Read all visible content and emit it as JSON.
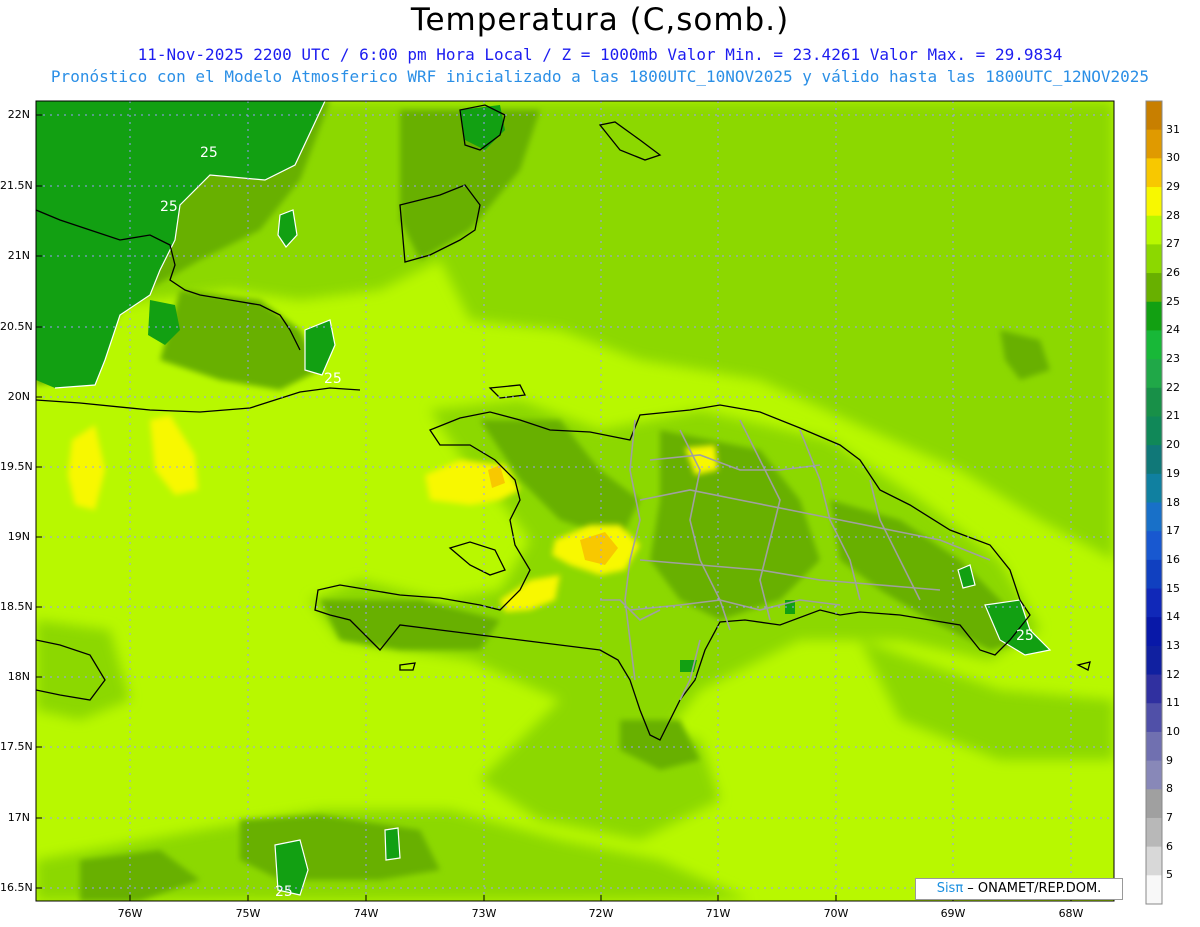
{
  "title": "Temperatura (C,somb.)",
  "subtitle_line1": "11-Nov-2025 2200 UTC / 6:00 pm Hora Local / Z = 1000mb   Valor Min. = 23.4261  Valor Max. = 29.9834",
  "subtitle_line2": "Pronóstico con el Modelo Atmosferico WRF inicializado a las 1800UTC_10NOV2025 y válido hasta las  1800UTC_12NOV2025",
  "credit": {
    "brand": "Sisπ",
    "text": " – ONAMET/REP.DOM."
  },
  "map": {
    "lat_labels": [
      "22N",
      "21.5N",
      "21N",
      "20.5N",
      "20N",
      "19.5N",
      "19N",
      "18.5N",
      "18N",
      "17.5N",
      "17N",
      "16.5N"
    ],
    "lon_labels": [
      "76W",
      "75W",
      "74W",
      "73W",
      "72W",
      "71W",
      "70W",
      "69W",
      "68W"
    ],
    "contour_labels": [
      "25",
      "25",
      "25",
      "25",
      "25"
    ],
    "min_value": 23.4261,
    "max_value": 29.9834,
    "units": "C",
    "level": "1000mb"
  },
  "colorbar": {
    "labels": [
      "31",
      "30",
      "29",
      "28",
      "27",
      "26",
      "25",
      "24",
      "23",
      "22",
      "21",
      "20",
      "19",
      "18",
      "17",
      "16",
      "15",
      "14",
      "13",
      "12",
      "11",
      "10",
      "9",
      "8",
      "7",
      "6",
      "5"
    ],
    "colors": [
      "#c87f00",
      "#e09a00",
      "#f8c800",
      "#f8f800",
      "#b8f800",
      "#8cd800",
      "#68b000",
      "#12a012",
      "#18b838",
      "#20a848",
      "#189048",
      "#108858",
      "#107878",
      "#1080a0",
      "#1870c8",
      "#1858d0",
      "#1040c0",
      "#1028b8",
      "#0818a8",
      "#1020a0",
      "#3030a0",
      "#5050a8",
      "#7070b0",
      "#8888b8",
      "#a0a0a0",
      "#b8b8b8",
      "#d8d8d8",
      "#f8f8f8"
    ]
  }
}
